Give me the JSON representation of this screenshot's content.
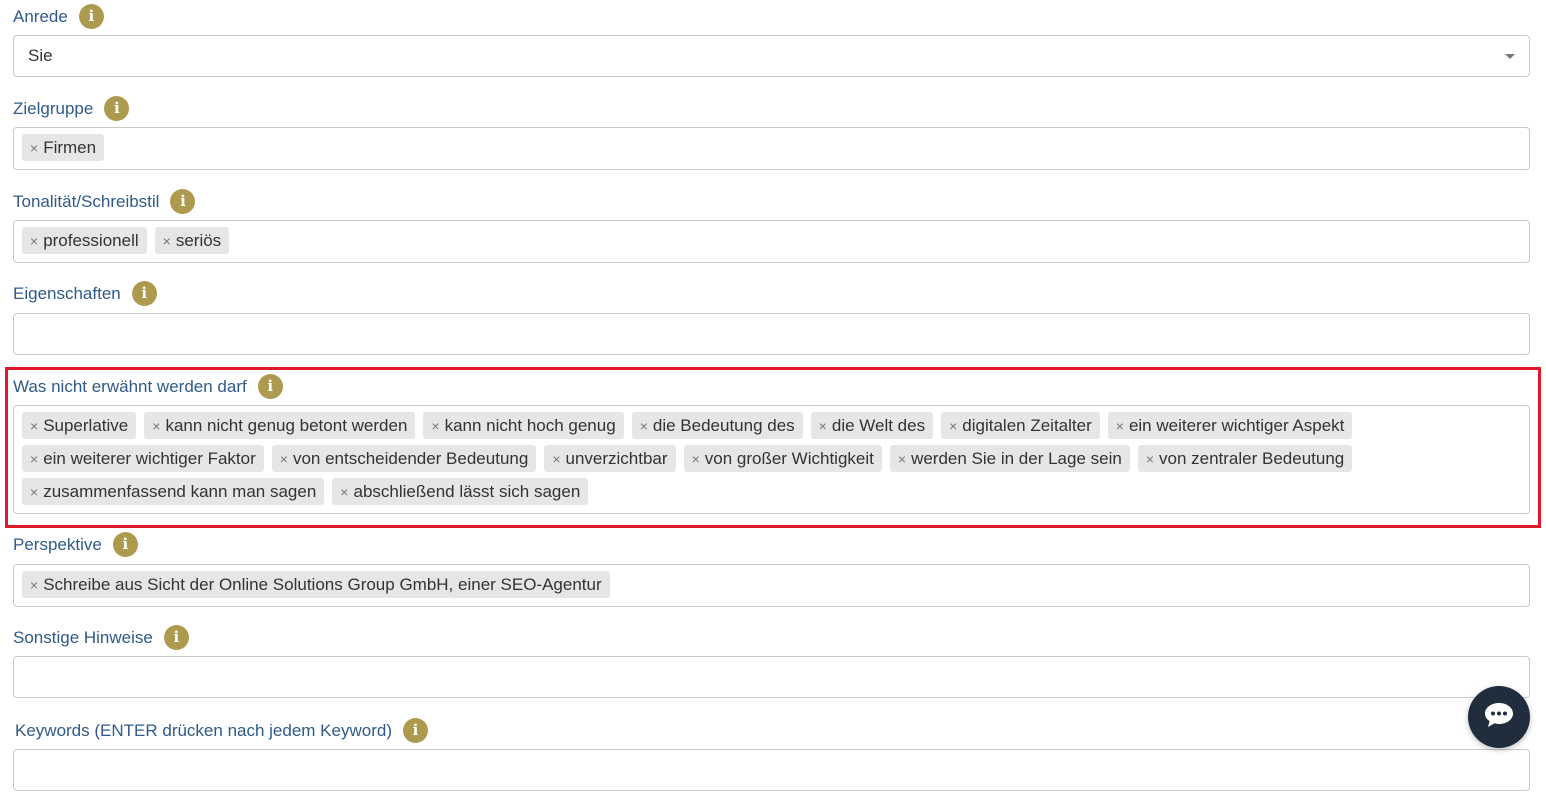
{
  "fields": {
    "anrede": {
      "label": "Anrede",
      "value": "Sie"
    },
    "zielgruppe": {
      "label": "Zielgruppe",
      "tags": [
        "Firmen"
      ]
    },
    "tonalitaet": {
      "label": "Tonalität/Schreibstil",
      "tags": [
        "professionell",
        "seriös"
      ]
    },
    "eigenschaften": {
      "label": "Eigenschaften",
      "tags": []
    },
    "verboten": {
      "label": "Was nicht erwähnt werden darf",
      "tags": [
        "Superlative",
        "kann nicht genug betont werden",
        "kann nicht hoch genug",
        "die Bedeutung des",
        "die Welt des",
        "digitalen Zeitalter",
        "ein weiterer wichtiger Aspekt",
        "ein weiterer wichtiger Faktor",
        "von entscheidender Bedeutung",
        "unverzichtbar",
        "von großer Wichtigkeit",
        "werden Sie in der Lage sein",
        "von zentraler Bedeutung",
        "zusammenfassend kann man sagen",
        "abschließend lässt sich sagen"
      ]
    },
    "perspektive": {
      "label": "Perspektive",
      "tags": [
        "Schreibe aus Sicht der Online Solutions Group GmbH, einer SEO-Agentur"
      ]
    },
    "hinweise": {
      "label": "Sonstige Hinweise",
      "tags": []
    },
    "keywords": {
      "label": "Keywords (ENTER drücken nach jedem Keyword)",
      "tags": []
    }
  },
  "tag_remove_glyph": "×",
  "info_glyph": "i",
  "colors": {
    "label": "#2f5a8a",
    "info": "#ad9a4f",
    "highlight": "#e0192a",
    "chat": "#1f2d3d"
  },
  "icons": {
    "info": "info-icon",
    "chat": "chat-bubble-icon",
    "caret": "chevron-down-icon"
  }
}
